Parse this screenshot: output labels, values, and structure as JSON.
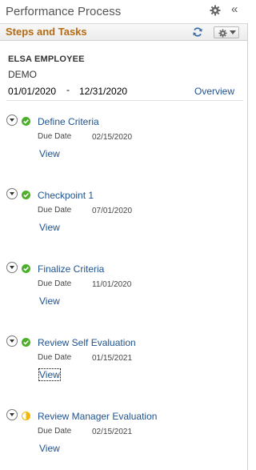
{
  "header": {
    "title": "Performance Process",
    "settings_icon": "gear-icon",
    "collapse_icon": "double-chevron-left-icon",
    "collapse_glyph": "«"
  },
  "section": {
    "title": "Steps and Tasks",
    "refresh_icon": "refresh-icon",
    "menu_icon": "gear-icon"
  },
  "employee": {
    "name": "ELSA EMPLOYEE",
    "id": "DEMO",
    "period_start": "01/01/2020",
    "period_separator": "-",
    "period_end": "12/31/2020",
    "overview_label": "Overview"
  },
  "colors": {
    "link": "#20538f",
    "section_title": "#b36b12",
    "complete": "#4caf2a",
    "in_progress": "#f2b705"
  },
  "steps": [
    {
      "title": "Define Criteria",
      "due_label": "Due Date",
      "due_date": "02/15/2020",
      "action": "View",
      "status": "complete"
    },
    {
      "title": "Checkpoint 1",
      "due_label": "Due Date",
      "due_date": "07/01/2020",
      "action": "View",
      "status": "complete"
    },
    {
      "title": "Finalize Criteria",
      "due_label": "Due Date",
      "due_date": "11/01/2020",
      "action": "View",
      "status": "complete"
    },
    {
      "title": "Review Self Evaluation",
      "due_label": "Due Date",
      "due_date": "01/15/2021",
      "action": "View",
      "status": "complete"
    },
    {
      "title": "Review Manager Evaluation",
      "due_label": "Due Date",
      "due_date": "02/15/2021",
      "action": "View",
      "status": "in-progress"
    }
  ]
}
